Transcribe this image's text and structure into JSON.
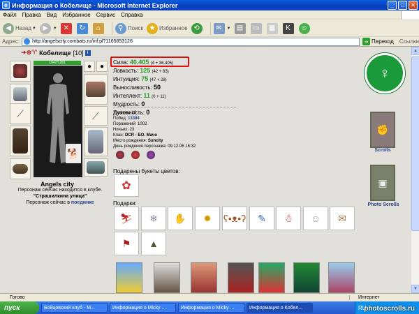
{
  "window": {
    "title": "Информация о Кобелище - Microsoft Internet Explorer",
    "buttons": {
      "minimize": "_",
      "maximize": "□",
      "close": "✕"
    }
  },
  "menu": [
    "Файл",
    "Правка",
    "Вид",
    "Избранное",
    "Сервис",
    "Справка"
  ],
  "toolbar": {
    "back": "Назад",
    "search": "Поиск",
    "favorites": "Избранное"
  },
  "address": {
    "label": "Адрес:",
    "url": "http://angelscity.combats.ru/inf.pl?1165653126",
    "go": "Переход",
    "links": "Ссылки"
  },
  "character": {
    "name": "Кобелище",
    "level": "[10]",
    "hp": "1047/1281",
    "city": "Angels city",
    "club_line1": "Персонаж сейчас находится в клубе.",
    "club_room": "\"Страшилкина улица\"",
    "club_line2": "Персонаж сейчас в",
    "club_place": "поединке"
  },
  "stats": [
    {
      "label": "Сила:",
      "value": "40.405",
      "bonus": "(4 + 36.405)",
      "color": "#2a9a2a"
    },
    {
      "label": "Ловкость:",
      "value": "125",
      "bonus": "(42 + 83)",
      "color": "#2a9a2a"
    },
    {
      "label": "Интуиция:",
      "value": "75",
      "bonus": "(47 + 28)",
      "color": "#2a9a2a"
    },
    {
      "label": "Выносливость:",
      "value": "50",
      "bonus": "",
      "color": "#000"
    },
    {
      "label": "Интеллект:",
      "value": "11",
      "bonus": "(0 + 11)",
      "color": "#2a9a2a"
    },
    {
      "label": "Мудрость:",
      "value": "0",
      "bonus": "",
      "color": "#000"
    },
    {
      "label": "Духовность:",
      "value": "0",
      "bonus": "",
      "color": "#000"
    }
  ],
  "info": {
    "level": "Уровень: 10",
    "wins_label": "Побед:",
    "wins": "13384",
    "losses": "Поражений: 1002",
    "draws": "Ничьих: 23",
    "clan_label": "Клан:",
    "clan": "DCR - БО. Мачо",
    "birthplace_label": "Место рождения:",
    "birthplace": "Suncity",
    "birthday": "День рождения персонажа: 09.12.06 16:32"
  },
  "gifts": {
    "flowers_label": "Подарены букеты цветов:",
    "gifts_label": "Подарки:"
  },
  "right_panel": {
    "scrolls": "Scrolls",
    "photo_scrolls": "Photo Scrolls"
  },
  "status": {
    "done": "Готово",
    "zone": "Интернет"
  },
  "taskbar": {
    "start": "пуск",
    "tasks": [
      "Бойцовский клуб - M...",
      "Информация о Micky ...",
      "Информация о Micky ...",
      "Информация о Кобел..."
    ],
    "tray": "RU",
    "watermark": "photoscrolls.ru"
  }
}
